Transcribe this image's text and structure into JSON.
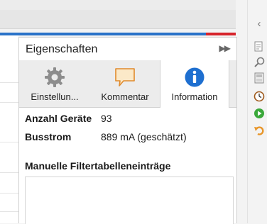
{
  "panel": {
    "title": "Eigenschaften",
    "collapse_glyph": "▶▶"
  },
  "tabs": [
    {
      "label": "Einstellun...",
      "icon": "gear-icon",
      "active": false
    },
    {
      "label": "Kommentar",
      "icon": "speech-bubble-icon",
      "active": false
    },
    {
      "label": "Information",
      "icon": "info-icon",
      "active": true
    }
  ],
  "info": {
    "rows": [
      {
        "key": "Anzahl Geräte",
        "value": "93"
      },
      {
        "key": "Busstrom",
        "value": "889 mA (geschätzt)"
      }
    ],
    "filter_section_title": "Manuelle Filtertabelleneinträge"
  },
  "toolbar": {
    "icons": [
      "chevron-left-icon",
      "document-icon",
      "search-icon",
      "panel-icon",
      "clock-icon",
      "play-icon",
      "undo-icon"
    ],
    "collapse_glyph": "‹"
  },
  "colors": {
    "accent_blue": "#2a73c9",
    "accent_red": "#d7242b",
    "info_blue": "#1e6fd0",
    "play_green": "#3aa83a",
    "undo_orange": "#e8962a"
  }
}
